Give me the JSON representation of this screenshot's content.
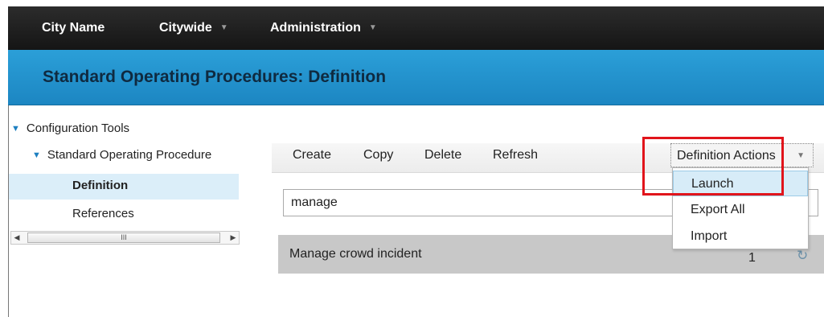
{
  "topnav": {
    "city": "City Name",
    "citywide": "Citywide",
    "administration": "Administration"
  },
  "page": {
    "title": "Standard Operating Procedures: Definition"
  },
  "sidebar": {
    "tree": [
      {
        "label": "Configuration Tools",
        "expanded": true
      },
      {
        "label": "Standard Operating Procedure",
        "expanded": true
      },
      {
        "label": "Definition",
        "selected": true
      },
      {
        "label": "References",
        "selected": false
      }
    ],
    "scroll_thumb_glyph": "III"
  },
  "toolbar": {
    "create": "Create",
    "copy": "Copy",
    "delete": "Delete",
    "refresh": "Refresh",
    "definition_actions": "Definition Actions"
  },
  "search": {
    "value": "manage"
  },
  "results": [
    {
      "name": "Manage crowd incident",
      "count": "1"
    }
  ],
  "menu": {
    "items": [
      "Launch",
      "Export All",
      "Import"
    ],
    "hovered": "Launch"
  },
  "colors": {
    "topbar": "#1f1f1f",
    "titlebar": "#1c8fcc",
    "highlight": "#e1141b",
    "selected_row": "#dbeef9"
  }
}
